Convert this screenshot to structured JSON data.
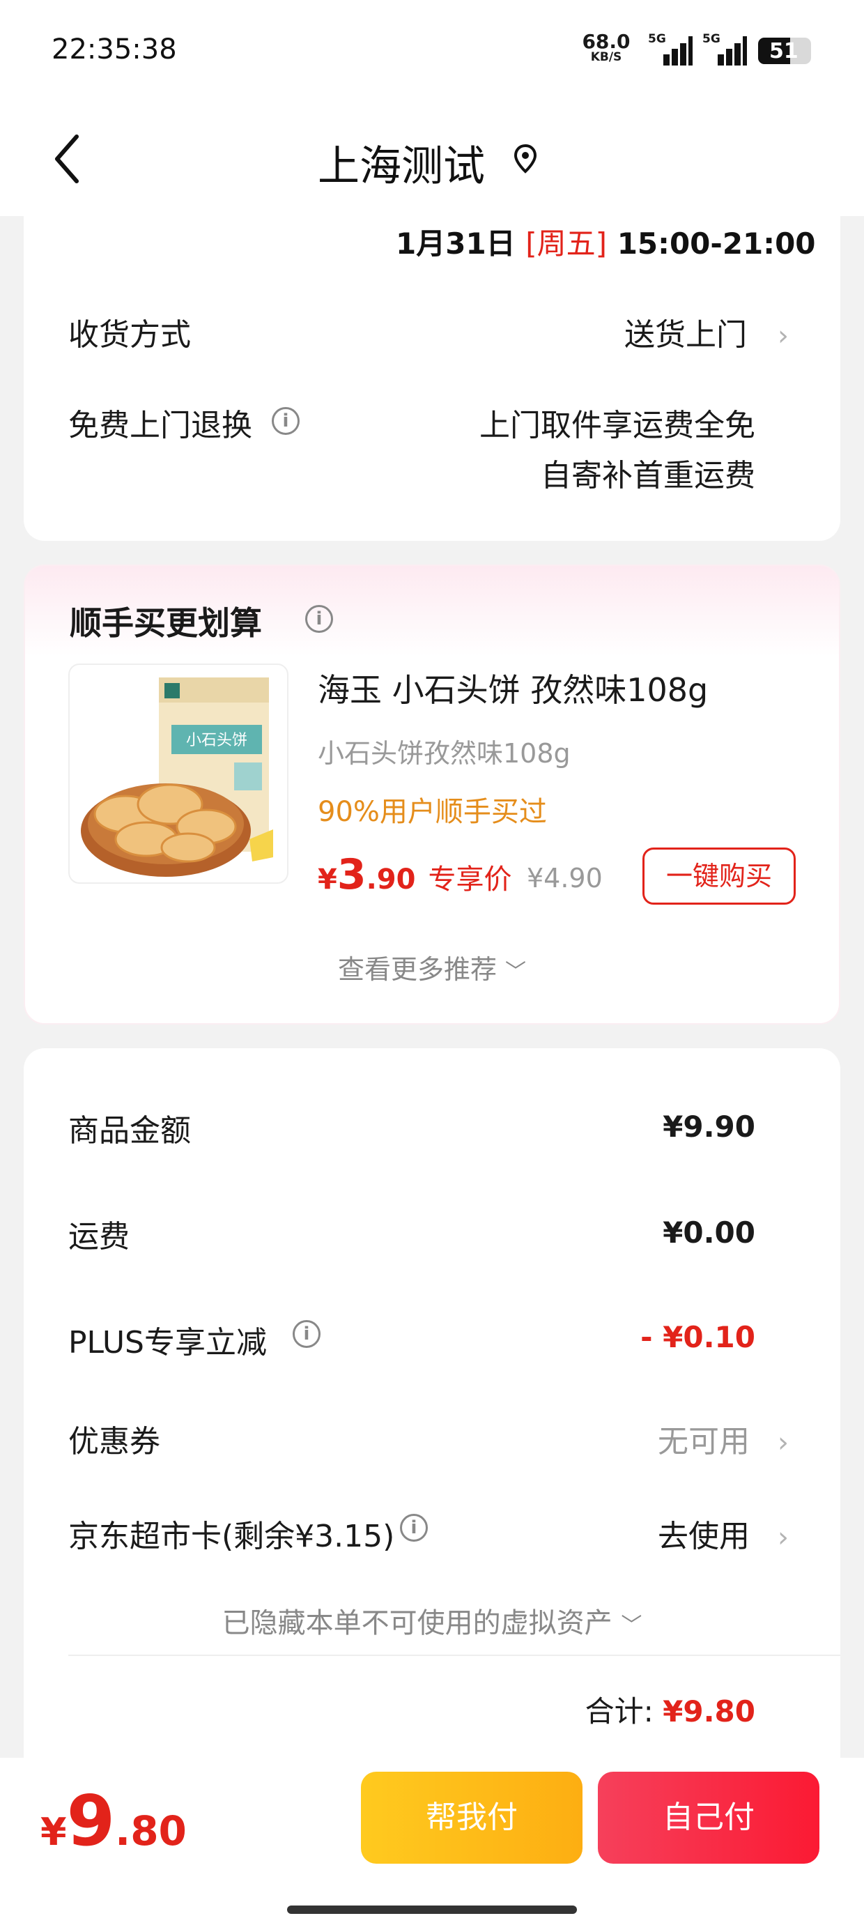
{
  "status_bar": {
    "time": "22:35:38",
    "net_speed_value": "68.0",
    "net_speed_unit": "KB/S",
    "signal1_label": "5G",
    "signal2_label": "5G",
    "battery_level": "51"
  },
  "header": {
    "title": "上海测试",
    "back_icon": "chevron-left-icon",
    "location_icon": "location-pin-icon"
  },
  "delivery": {
    "date": "1月31日",
    "weekday": "[周五]",
    "time_range": "15:00-21:00",
    "method_label": "收货方式",
    "method_value": "送货上门",
    "return_label": "免费上门退换",
    "return_line1": "上门取件享运费全免",
    "return_line2": "自寄补首重运费"
  },
  "recommend": {
    "title": "顺手买更划算",
    "product": {
      "name": "海玉 小石头饼 孜然味108g",
      "spec": "小石头饼孜然味108g",
      "purchase_rate": "90%用户顺手买过",
      "price_symbol": "¥",
      "price_int": "3",
      "price_dec": ".90",
      "price_tag": "专享价",
      "original_price": "¥4.90",
      "buy_button": "一键购买",
      "package_text": "小石头饼"
    },
    "more": "查看更多推荐"
  },
  "summary": {
    "goods_label": "商品金额",
    "goods_value": "¥9.90",
    "shipping_label": "运费",
    "shipping_value": "¥0.00",
    "plus_label": "PLUS专享立减",
    "plus_value": "- ¥0.10",
    "coupon_label": "优惠券",
    "coupon_value": "无可用",
    "card_label": "京东超市卡(剩余¥3.15)",
    "card_value": "去使用",
    "hidden_note": "已隐藏本单不可使用的虚拟资产",
    "total_label": "合计:",
    "total_value": "¥9.80"
  },
  "bottom_bar": {
    "price_symbol": "¥",
    "price_int": "9",
    "price_dec": ".80",
    "help_pay": "帮我付",
    "self_pay": "自己付"
  },
  "colors": {
    "accent_red": "#e2231a",
    "orange_text": "#e58d1b",
    "help_pay_yellow": "#fdb515",
    "self_pay_red": "#fb2a42"
  }
}
